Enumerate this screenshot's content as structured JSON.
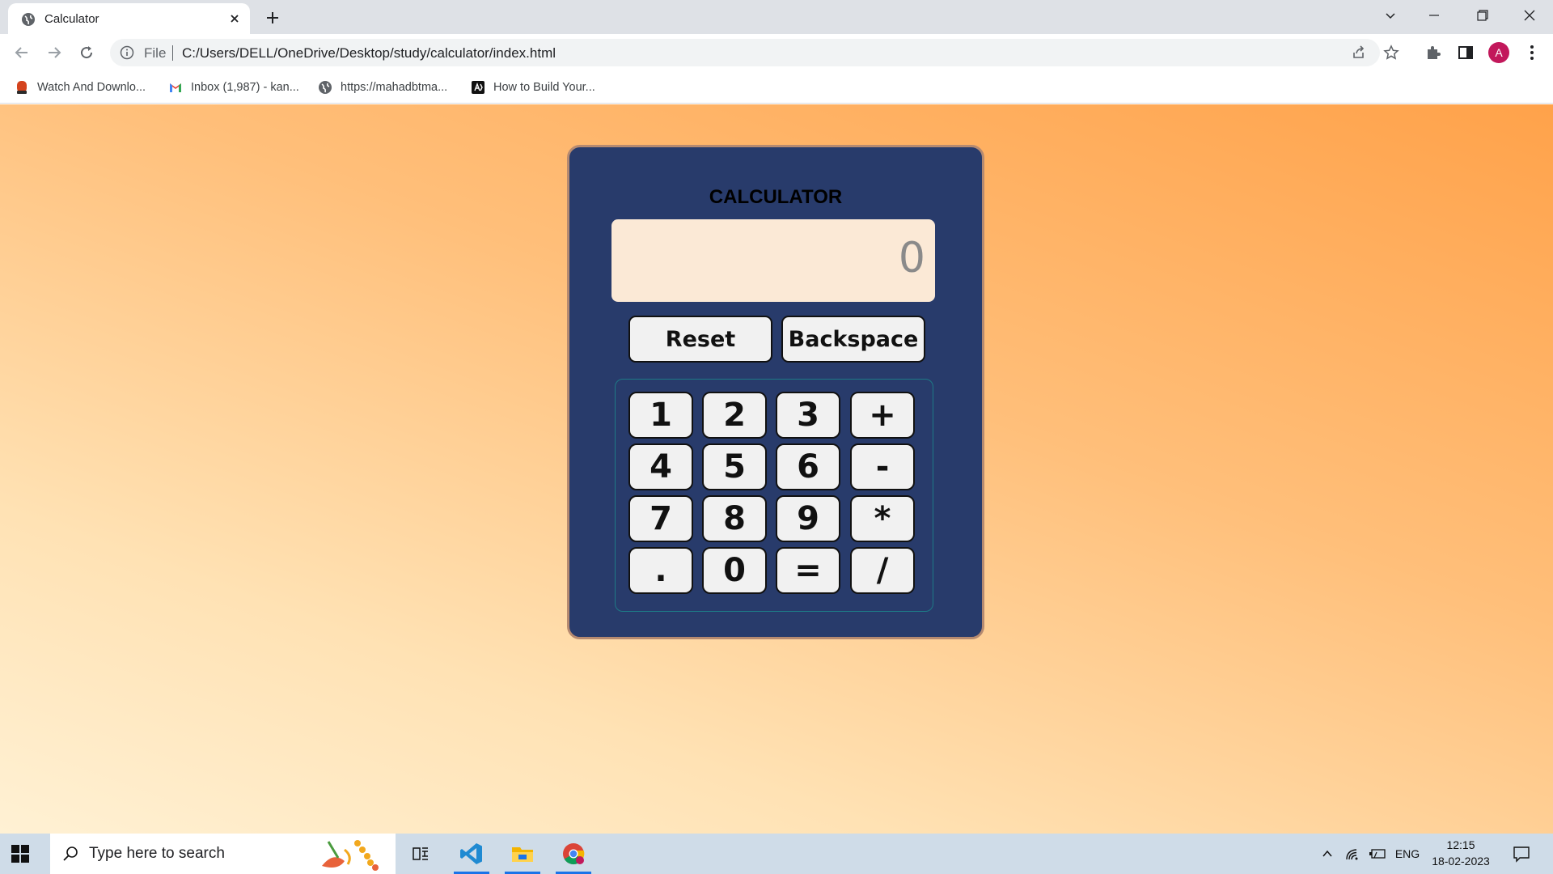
{
  "browser": {
    "tab_title": "Calculator",
    "omnibox_scheme": "File",
    "url": "C:/Users/DELL/OneDrive/Desktop/study/calculator/index.html",
    "profile_initial": "A",
    "bookmarks": [
      {
        "label": "Watch And Downlo...",
        "icon": "app-icon"
      },
      {
        "label": "Inbox (1,987) - kan...",
        "icon": "gmail-icon"
      },
      {
        "label": "https://mahadbtma...",
        "icon": "globe-icon"
      },
      {
        "label": "How to Build Your...",
        "icon": "site-icon"
      }
    ]
  },
  "calculator": {
    "title": "CALCULATOR",
    "display_value": "0",
    "reset_label": "Reset",
    "backspace_label": "Backspace",
    "keys": [
      [
        "1",
        "2",
        "3",
        "+"
      ],
      [
        "4",
        "5",
        "6",
        "-"
      ],
      [
        "7",
        "8",
        "9",
        "*"
      ],
      [
        ".",
        "0",
        "=",
        "/"
      ]
    ],
    "colors": {
      "panel": "#283b6b",
      "display": "#fbe9d6",
      "key": "#f1f1f1"
    }
  },
  "taskbar": {
    "search_placeholder": "Type here to search",
    "language": "ENG",
    "time": "12:15",
    "date": "18-02-2023"
  }
}
